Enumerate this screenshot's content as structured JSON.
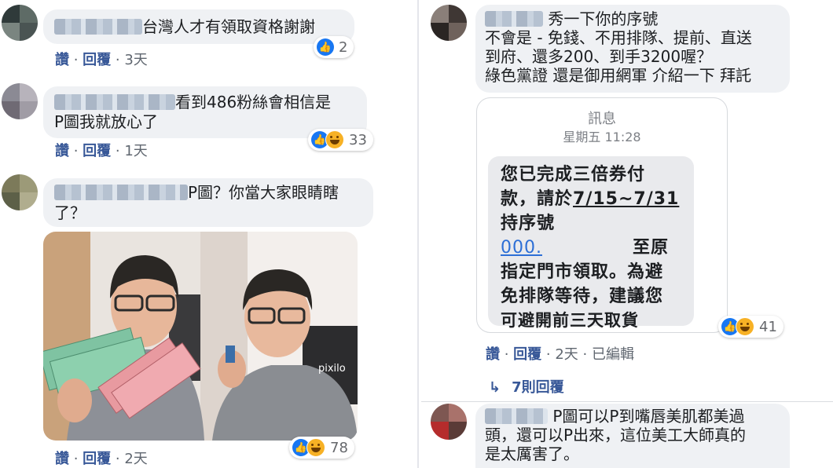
{
  "left": {
    "comments": [
      {
        "text": "台灣人才有領取資格謝謝",
        "actions": [
          "讚",
          "回覆"
        ],
        "time": "3天",
        "reaction_count": "2"
      },
      {
        "text_line1": "看到486粉絲會相信是",
        "text_line2": "P圖我就放心了",
        "actions": [
          "讚",
          "回覆"
        ],
        "time": "1天",
        "reaction_count": "33"
      },
      {
        "text_line1": "P圖？你當大家眼睛瞎",
        "text_line2": "了？",
        "actions": [
          "讚",
          "回覆"
        ],
        "time": "2天",
        "reaction_count": "78"
      }
    ],
    "photo_watermark": "pixilo"
  },
  "right": {
    "post": {
      "text_line1": "秀一下你的序號",
      "text_line2": "不會是 - 免錢、不用排隊、提前、直送",
      "text_line3": "到府、還多200、到手3200喔？",
      "text_line4": "綠色黨證 還是御用網軍 介紹一下 拜託"
    },
    "message": {
      "header": "訊息",
      "time": "星期五 11:28",
      "line1": "您已完成三倍券付",
      "line2_a": "款，請於",
      "line2_b": "7/15~7/31",
      "line3": "持序號",
      "line4_link": "000.",
      "line4_b": "至原",
      "line5": "指定門市領取。為避",
      "line6": "免排隊等待，建議您",
      "line7": "可避開前三天取貨"
    },
    "post_meta": {
      "like": "讚",
      "reply": "回覆",
      "time": "2天",
      "edited": "已編輯",
      "reaction_count": "41"
    },
    "replies_link": "7則回覆",
    "reply_comment": {
      "line1": "P圖可以P到嘴唇美肌都美過",
      "line2": "頭，還可以P出來，這位美工大師真的",
      "line3": "是太厲害了。"
    }
  },
  "colors": {
    "like_blue": "#1877f2",
    "link_blue": "#385898",
    "bubble_grey": "#eff1f4"
  }
}
